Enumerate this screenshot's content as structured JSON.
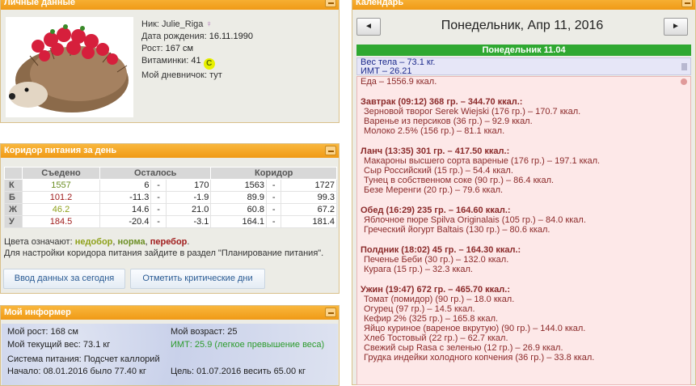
{
  "personal": {
    "title": "Личные данные",
    "nick_label": "Ник:",
    "nick": "Julie_Riga",
    "birth_label": "Дата рождения:",
    "birth": "16.11.1990",
    "height_label": "Рост:",
    "height": "167 см",
    "vitamins_label": "Витаминки:",
    "vitamins": "41",
    "vitamins_badge": "C",
    "diary_label": "Мой дневничок:",
    "diary": "тут"
  },
  "corridor": {
    "title": "Коридор питания за день",
    "headers": [
      "",
      "Съедено",
      "Осталось",
      "Коридор"
    ],
    "rows": [
      {
        "label": "К",
        "eaten": "1557",
        "left_a": "6",
        "left_b": "170",
        "cor_a": "1563",
        "cor_b": "1727",
        "color": "#6b8e23"
      },
      {
        "label": "Б",
        "eaten": "101.2",
        "left_a": "-11.3",
        "left_b": "-1.9",
        "cor_a": "89.9",
        "cor_b": "99.3",
        "color": "#a01c1c"
      },
      {
        "label": "Ж",
        "eaten": "46.2",
        "left_a": "14.6",
        "left_b": "21.0",
        "cor_a": "60.8",
        "cor_b": "67.2",
        "color": "#8ea11a"
      },
      {
        "label": "У",
        "eaten": "184.5",
        "left_a": "-20.4",
        "left_b": "-3.1",
        "cor_a": "164.1",
        "cor_b": "181.4",
        "color": "#a01c1c"
      }
    ],
    "dash": "-",
    "colors_prefix": "Цвета означают:",
    "legend_under": "недобор",
    "legend_norm": "норма",
    "legend_over": "перебор",
    "note": "Для настройки коридора питания зайдите в раздел \"Планирование питания\".",
    "btn_enter": "Ввод данных за сегодня",
    "btn_critical": "Отметить критические дни"
  },
  "informer": {
    "title": "Мой информер",
    "height": "Мой рост: 168 см",
    "age": "Мой возраст: 25",
    "weight": "Мой текущий вес: 73.1 кг",
    "bmi": "ИМТ: 25.9 (легкое превышение веса)",
    "system": "Система питания: Подсчет каллорий",
    "start": "Начало: 08.01.2016 было 77.40 кг",
    "goal": "Цель: 01.07.2016 весить 65.00 кг"
  },
  "calendar": {
    "title": "Календарь",
    "prev": "◄",
    "next": "►",
    "date": "Понедельник, Апр 11, 2016",
    "day_bar": "Понедельник 11.04",
    "weight": "Вес тела – 73.1 кг.",
    "bmi": "ИМТ – 26.21",
    "food_total": "Еда – 1556.9 ккал.",
    "meals": [
      {
        "head": "Завтрак (09:12) 368 гр. – 344.70 ккал.:",
        "items": [
          "Зерновой творог Serek Wiejski (176 гр.) – 170.7 ккал.",
          "Варенье из персиков (36 гр.) – 92.9 ккал.",
          "Молоко 2.5% (156 гр.) – 81.1 ккал."
        ]
      },
      {
        "head": "Ланч (13:35) 301 гр. – 417.50 ккал.:",
        "items": [
          "Макароны высшего сорта вареные (176 гр.) – 197.1 ккал.",
          "Сыр Российский (15 гр.) – 54.4 ккал.",
          "Тунец в собственном соке (90 гр.) – 86.4 ккал.",
          "Безе Меренги (20 гр.) – 79.6 ккал."
        ]
      },
      {
        "head": "Обед (16:29) 235 гр. – 164.60 ккал.:",
        "items": [
          "Яблочное пюре Spilva Originalais (105 гр.) – 84.0 ккал.",
          "Греческий йогурт Baltais (130 гр.) – 80.6 ккал."
        ]
      },
      {
        "head": "Полдник (18:02) 45 гр. – 164.30 ккал.:",
        "items": [
          "Печенье Беби (30 гр.) – 132.0 ккал.",
          "Курага (15 гр.) – 32.3 ккал."
        ]
      },
      {
        "head": "Ужин (19:47) 672 гр. – 465.70 ккал.:",
        "items": [
          "Томат (помидор) (90 гр.) – 18.0 ккал.",
          "Огурец (97 гр.) – 14.5 ккал.",
          "Кефир 2% (325 гр.) – 165.8 ккал.",
          "Яйцо куриное (вареное вкрутую) (90 гр.) – 144.0 ккал.",
          "Хлеб Тостовый (22 гр.) – 62.7 ккал.",
          "Свежий сыр Rasa с зеленью (12 гр.) – 26.9 ккал.",
          "Грудка индейки холодного копчения (36 гр.) – 33.8 ккал."
        ]
      }
    ]
  }
}
